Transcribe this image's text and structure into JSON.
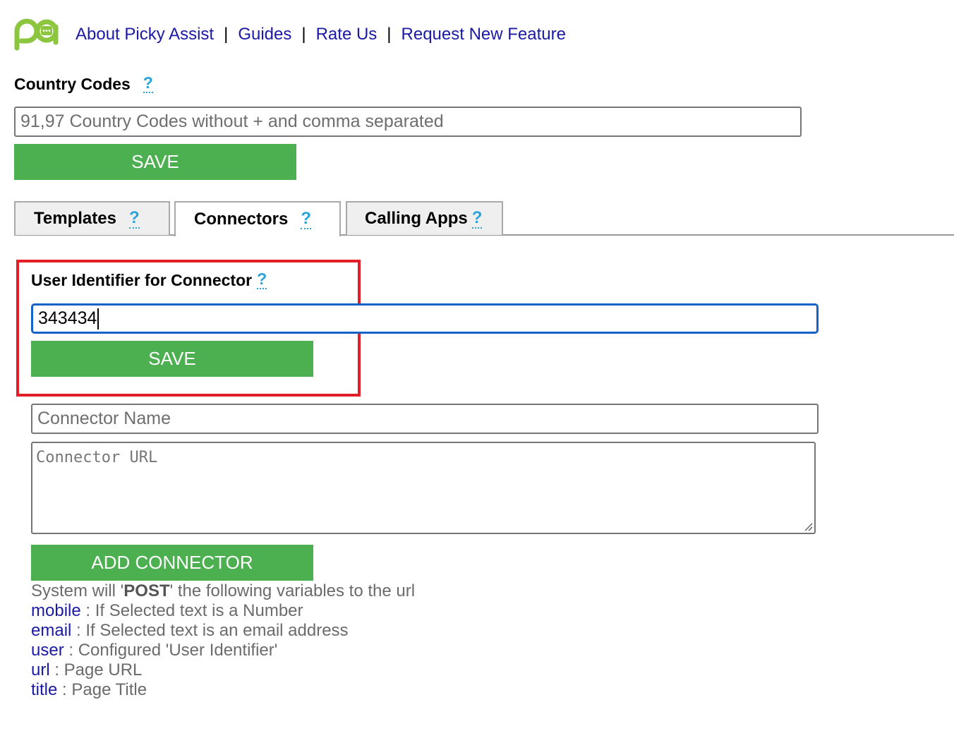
{
  "header": {
    "logo_icon": "picky-assist-logo-icon",
    "links": [
      "About Picky Assist",
      "Guides",
      "Rate Us",
      "Request New Feature"
    ],
    "separator": "|"
  },
  "country_codes": {
    "label": "Country Codes",
    "help": "?",
    "placeholder": "91,97 Country Codes without + and comma separated",
    "save_label": "SAVE"
  },
  "tabs": [
    {
      "label": "Templates",
      "help": "?",
      "active": false
    },
    {
      "label": "Connectors",
      "help": "?",
      "active": true
    },
    {
      "label": "Calling Apps",
      "help": "?",
      "active": false
    }
  ],
  "connector": {
    "user_identifier_label": "User Identifier for Connector",
    "help": "?",
    "user_identifier_value": "343434",
    "save_label": "SAVE",
    "name_placeholder": "Connector Name",
    "url_placeholder": "Connector URL",
    "add_label": "ADD CONNECTOR"
  },
  "info": {
    "intro_pre": "System will '",
    "intro_bold": "POST",
    "intro_post": "' the following variables to the url",
    "variables": [
      {
        "key": "mobile",
        "desc": " : If Selected text is a Number"
      },
      {
        "key": "email",
        "desc": " : If Selected text is an email address"
      },
      {
        "key": "user",
        "desc": " : Configured 'User Identifier'"
      },
      {
        "key": "url",
        "desc": " : Page URL"
      },
      {
        "key": "title",
        "desc": " : Page Title"
      }
    ]
  },
  "colors": {
    "accent_green": "#4caf50",
    "link_blue": "#1a1aa6",
    "help_blue": "#2aa4d8",
    "highlight_red": "#e41e26",
    "focus_blue": "#1262c8"
  }
}
